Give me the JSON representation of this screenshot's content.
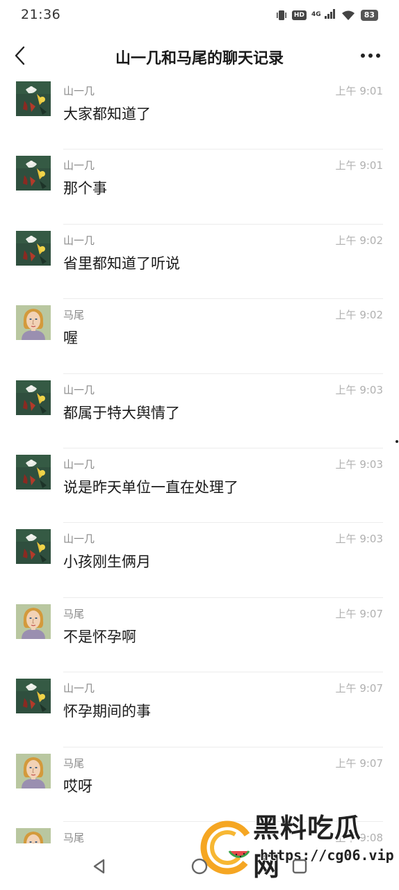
{
  "status_bar": {
    "time": "21:36",
    "hd_badge": "HD",
    "network": "4G",
    "battery": "83"
  },
  "header": {
    "title": "山一几和马尾的聊天记录"
  },
  "messages": [
    {
      "sender": "山一几",
      "time": "上午 9:01",
      "text": "大家都知道了",
      "avatar": "art-avatar"
    },
    {
      "sender": "山一几",
      "time": "上午 9:01",
      "text": "那个事",
      "avatar": "art-avatar"
    },
    {
      "sender": "山一几",
      "time": "上午 9:02",
      "text": "省里都知道了听说",
      "avatar": "art-avatar"
    },
    {
      "sender": "马尾",
      "time": "上午 9:02",
      "text": "喔",
      "avatar": "portrait-avatar"
    },
    {
      "sender": "山一几",
      "time": "上午 9:03",
      "text": "都属于特大舆情了",
      "avatar": "art-avatar"
    },
    {
      "sender": "山一几",
      "time": "上午 9:03",
      "text": "说是昨天单位一直在处理了",
      "avatar": "art-avatar"
    },
    {
      "sender": "山一几",
      "time": "上午 9:03",
      "text": "小孩刚生俩月",
      "avatar": "art-avatar"
    },
    {
      "sender": "马尾",
      "time": "上午 9:07",
      "text": "不是怀孕啊",
      "avatar": "portrait-avatar"
    },
    {
      "sender": "山一几",
      "time": "上午 9:07",
      "text": "怀孕期间的事",
      "avatar": "art-avatar"
    },
    {
      "sender": "马尾",
      "time": "上午 9:07",
      "text": "哎呀",
      "avatar": "portrait-avatar"
    },
    {
      "sender": "马尾",
      "time": "上午 9:08",
      "text": "",
      "avatar": "portrait-avatar"
    }
  ],
  "watermark": {
    "title": "黑料吃瓜网",
    "url": "https://cg06.vip"
  },
  "colors": {
    "art_avatar_bg": "#2f4f3e",
    "portrait_avatar_bg": "#b9c7a0",
    "watermark_orange": "#f5a623",
    "watermark_green": "#3aa34a"
  }
}
